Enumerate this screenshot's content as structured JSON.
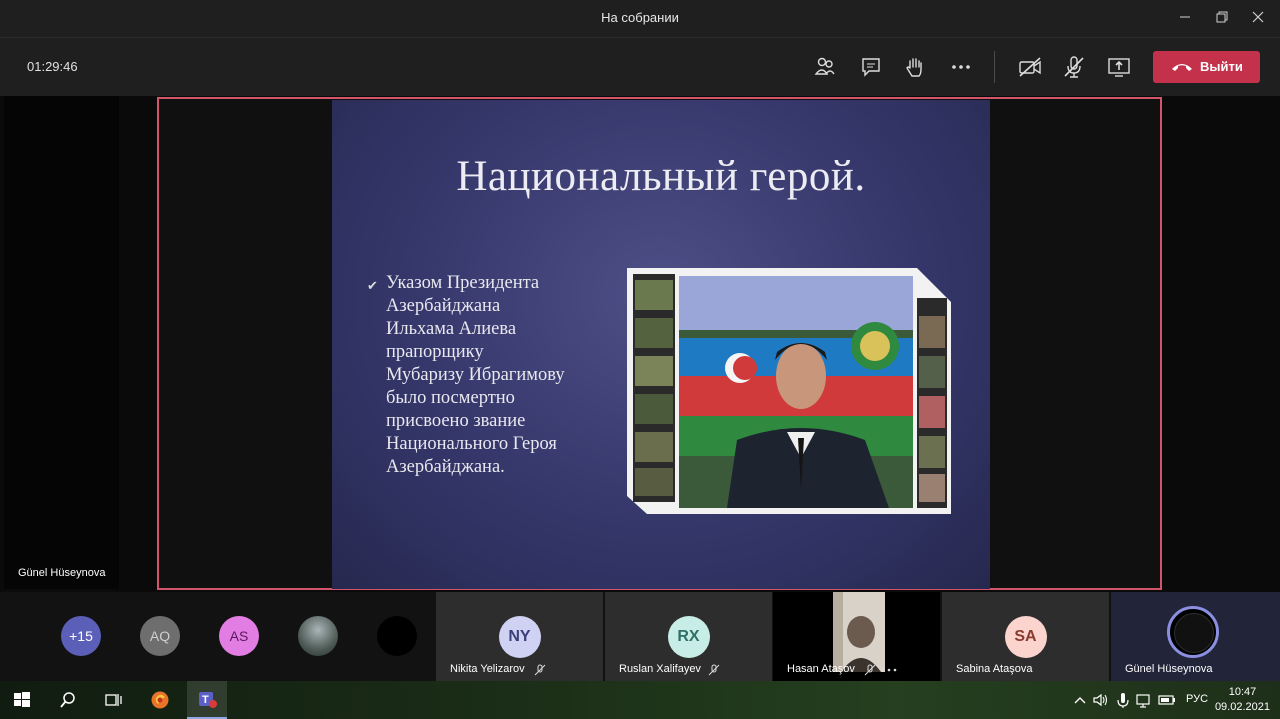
{
  "window": {
    "title": "На собрании"
  },
  "toolbar": {
    "timer": "01:29:46",
    "leave_label": "Выйти"
  },
  "slide": {
    "title": "Национальный герой.",
    "lines": [
      "Указом Президента",
      "Азербайджана",
      "Ильхама Алиева",
      "прапорщику",
      "Мубаризу Ибрагимову",
      "было посмертно",
      "присвоено звание",
      "Национального Героя",
      "Азербайджана."
    ]
  },
  "stage": {
    "left_participant": "Günel Hüseynova"
  },
  "participants_small": [
    {
      "initials": "+15",
      "color": "#5c5fb8"
    },
    {
      "initials": "AQ",
      "color": "#6e6e6e"
    },
    {
      "initials": "AS",
      "color": "#e27de3"
    }
  ],
  "participants": [
    {
      "name": "Nikita Yelizarov",
      "initials": "NY",
      "color": "#cfd2f2"
    },
    {
      "name": "Ruslan Xalifayev",
      "initials": "RX",
      "color": "#c8ece6"
    },
    {
      "name": "Hasan Ataşov",
      "initials": "",
      "color": ""
    },
    {
      "name": "Sabina Ataşova",
      "initials": "SA",
      "color": "#fbd4cd"
    },
    {
      "name": "Günel Hüseynova",
      "initials": "",
      "color": ""
    }
  ],
  "taskbar": {
    "language": "РУС",
    "time": "10:47",
    "date": "09.02.2021"
  }
}
